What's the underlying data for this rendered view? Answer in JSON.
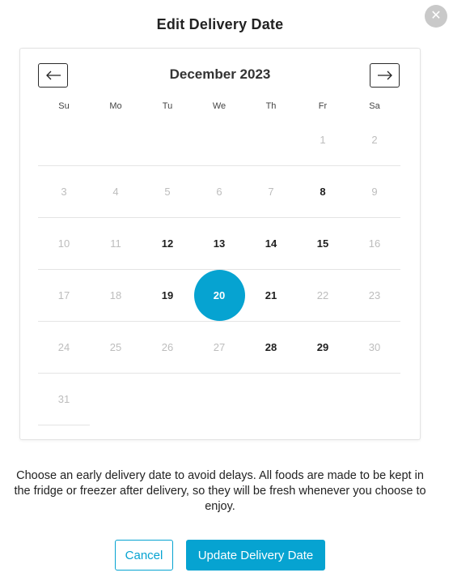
{
  "dialog": {
    "title": "Edit Delivery Date",
    "close_icon": "close-icon"
  },
  "calendar": {
    "month_label": "December 2023",
    "prev_icon": "arrow-left-icon",
    "next_icon": "arrow-right-icon",
    "weekdays": [
      "Su",
      "Mo",
      "Tu",
      "We",
      "Th",
      "Fr",
      "Sa"
    ],
    "weeks": [
      [
        {
          "label": "",
          "state": "empty"
        },
        {
          "label": "",
          "state": "empty"
        },
        {
          "label": "",
          "state": "empty"
        },
        {
          "label": "",
          "state": "empty"
        },
        {
          "label": "",
          "state": "empty"
        },
        {
          "label": "1",
          "state": "disabled"
        },
        {
          "label": "2",
          "state": "disabled"
        }
      ],
      [
        {
          "label": "3",
          "state": "disabled"
        },
        {
          "label": "4",
          "state": "disabled"
        },
        {
          "label": "5",
          "state": "disabled"
        },
        {
          "label": "6",
          "state": "disabled"
        },
        {
          "label": "7",
          "state": "disabled"
        },
        {
          "label": "8",
          "state": "available"
        },
        {
          "label": "9",
          "state": "disabled"
        }
      ],
      [
        {
          "label": "10",
          "state": "disabled"
        },
        {
          "label": "11",
          "state": "disabled"
        },
        {
          "label": "12",
          "state": "available"
        },
        {
          "label": "13",
          "state": "available"
        },
        {
          "label": "14",
          "state": "available"
        },
        {
          "label": "15",
          "state": "available"
        },
        {
          "label": "16",
          "state": "disabled"
        }
      ],
      [
        {
          "label": "17",
          "state": "disabled"
        },
        {
          "label": "18",
          "state": "disabled"
        },
        {
          "label": "19",
          "state": "available"
        },
        {
          "label": "20",
          "state": "selected"
        },
        {
          "label": "21",
          "state": "available"
        },
        {
          "label": "22",
          "state": "disabled"
        },
        {
          "label": "23",
          "state": "disabled"
        }
      ],
      [
        {
          "label": "24",
          "state": "disabled"
        },
        {
          "label": "25",
          "state": "disabled"
        },
        {
          "label": "26",
          "state": "disabled"
        },
        {
          "label": "27",
          "state": "disabled"
        },
        {
          "label": "28",
          "state": "available"
        },
        {
          "label": "29",
          "state": "available"
        },
        {
          "label": "30",
          "state": "disabled"
        }
      ],
      [
        {
          "label": "31",
          "state": "disabled"
        }
      ]
    ]
  },
  "info_text": "Choose an early delivery date to avoid delays. All foods are made to be kept in the fridge or freezer after delivery, so they will be fresh whenever you choose to enjoy.",
  "actions": {
    "cancel_label": "Cancel",
    "update_label": "Update Delivery Date"
  },
  "colors": {
    "accent": "#06a3d1",
    "disabled_text": "#bdbdbd",
    "close_button_bg": "#c9c9c9"
  }
}
